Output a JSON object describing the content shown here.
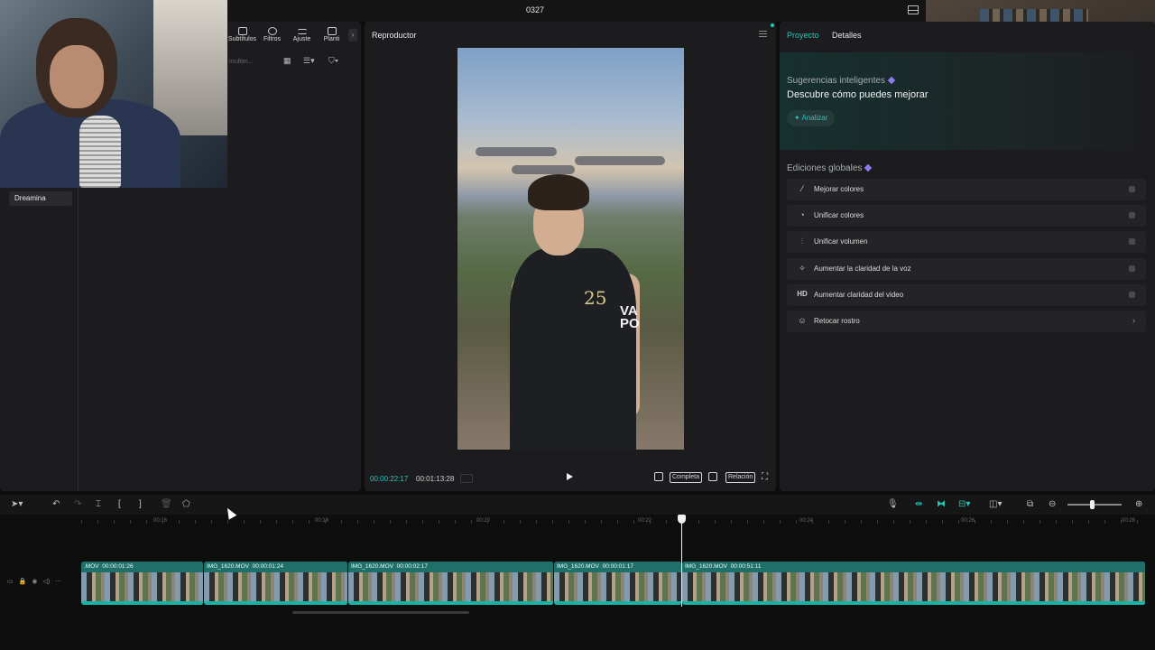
{
  "window": {
    "title": "0327"
  },
  "media_panel": {
    "tabs": [
      {
        "label": "Subtítulos"
      },
      {
        "label": "Filtros"
      },
      {
        "label": "Ajuste"
      },
      {
        "label": "Planti"
      }
    ],
    "search_placeholder": "multim...",
    "folder_item": "Dreamina"
  },
  "player": {
    "title": "Reproductor",
    "time_current": "00:00:22:17",
    "time_total": "00:01:13:28",
    "quality_label": "Completa",
    "ratio_label": "Relación",
    "video_shirt_text_1": "25",
    "video_shirt_text_2": "VA\nPO"
  },
  "details_panel": {
    "tab_project": "Proyecto",
    "tab_details": "Detalles",
    "smart_title": "Sugerencias inteligentes",
    "smart_subtitle": "Descubre cómo puedes mejorar",
    "analyze_label": "Analizar",
    "global_title": "Ediciones globales",
    "edits": [
      {
        "label": "Mejorar colores",
        "icon": "magic-wand-icon"
      },
      {
        "label": "Unificar colores",
        "icon": "palette-icon"
      },
      {
        "label": "Unificar volumen",
        "icon": "sliders-icon"
      },
      {
        "label": "Aumentar la claridad de la voz",
        "icon": "sparkle-icon"
      },
      {
        "label": "Aumentar claridad del video",
        "icon": "hd-icon"
      },
      {
        "label": "Retocar rostro",
        "icon": "face-icon"
      }
    ],
    "accent_color": "#26c6b8"
  },
  "timeline": {
    "ruler_labels": [
      "00:16",
      "00:18",
      "00:20",
      "00:22",
      "00:24",
      "00:26",
      "00:28"
    ],
    "clips": [
      {
        "name": ".MOV",
        "duration": "00:00:01:26"
      },
      {
        "name": "IMG_1620.MOV",
        "duration": "00:00:01:24"
      },
      {
        "name": "IMG_1620.MOV",
        "duration": "00:00:02:17"
      },
      {
        "name": "IMG_1620.MOV",
        "duration": "00:00:01:17"
      },
      {
        "name": "IMG_1620.MOV",
        "duration": "00:00:51:11"
      }
    ]
  }
}
